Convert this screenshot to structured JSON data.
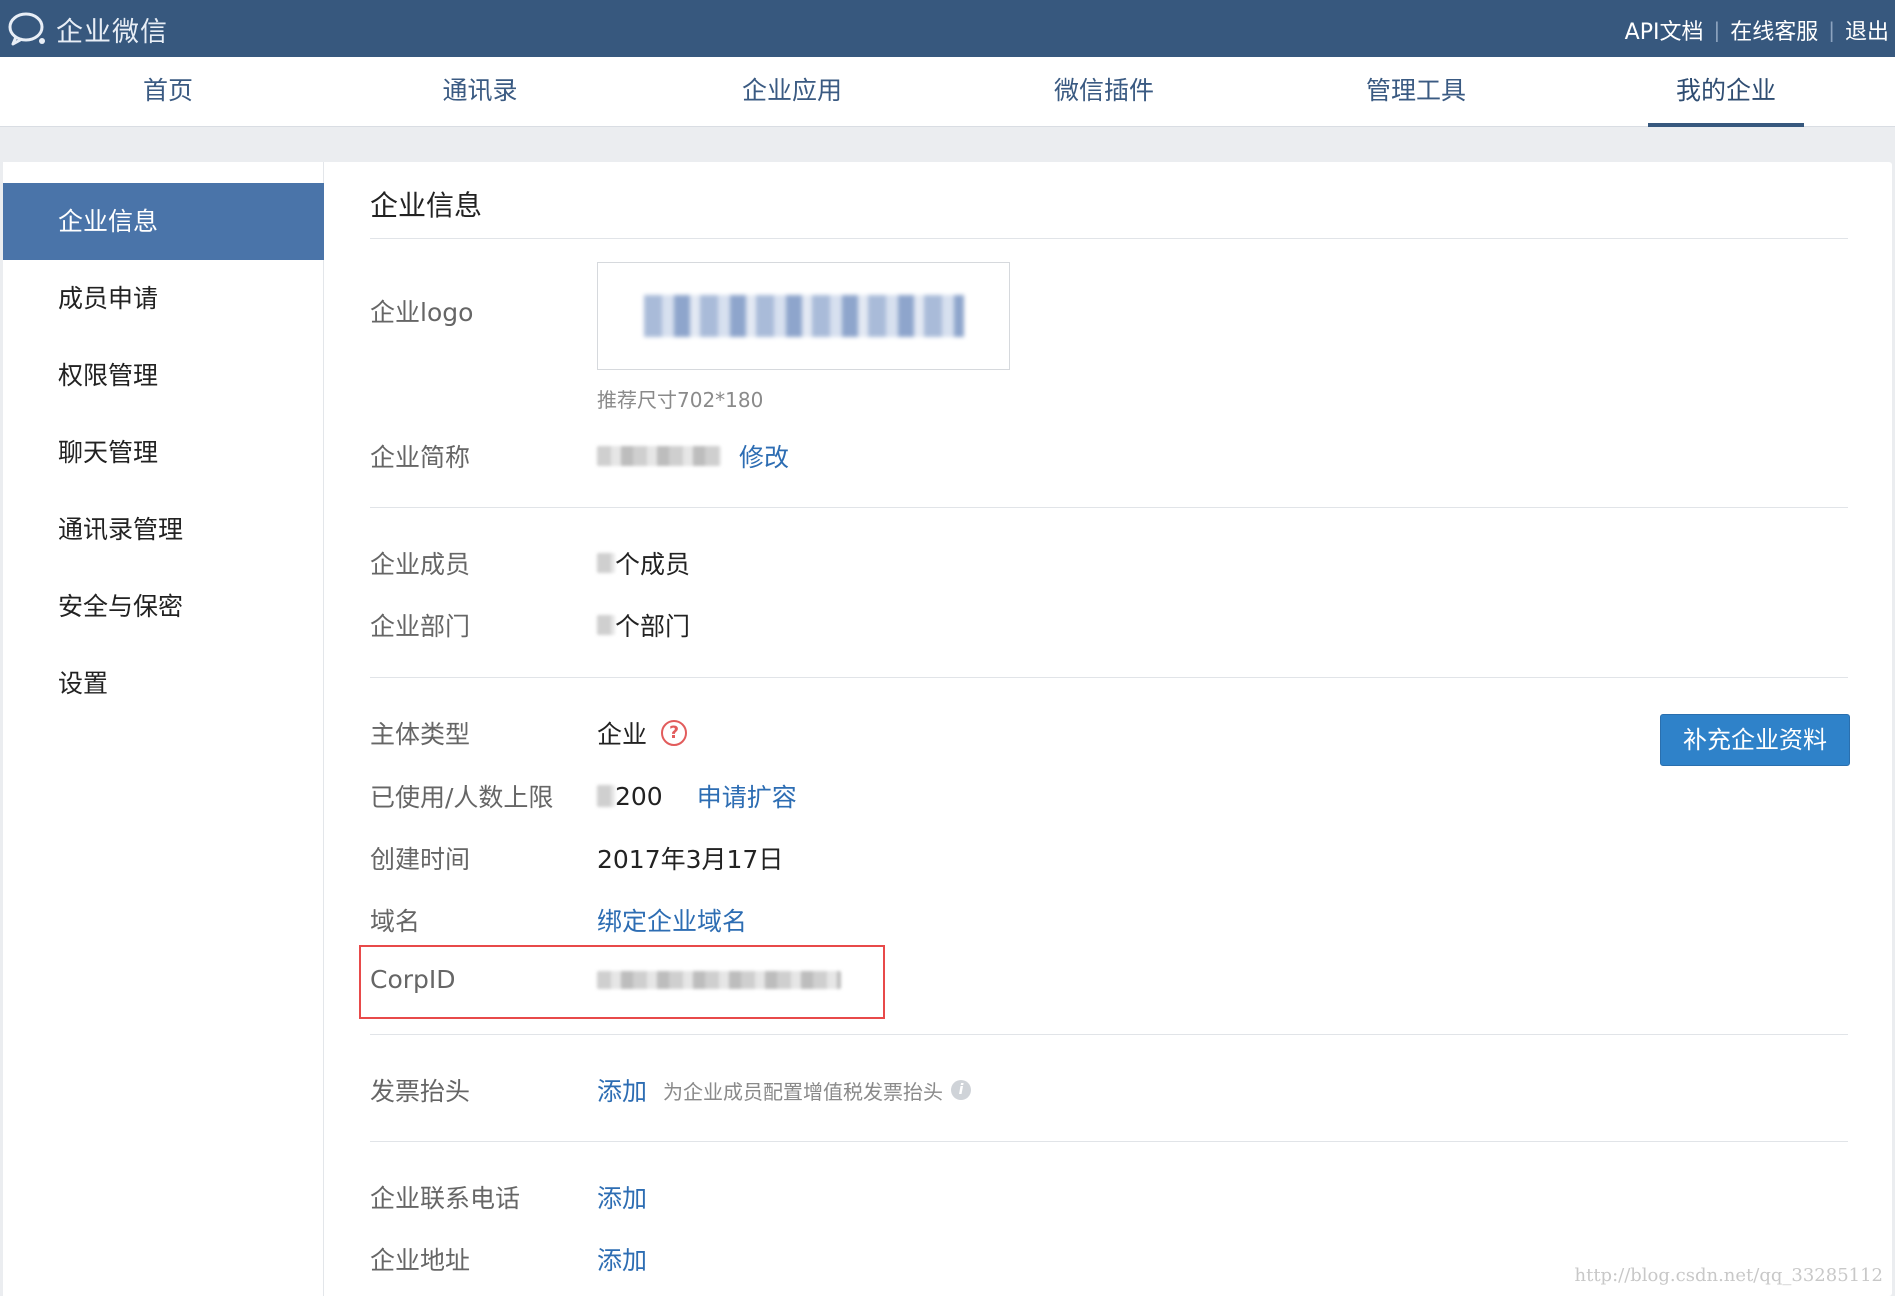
{
  "topbar": {
    "app_name": "企业微信",
    "links": [
      "API文档",
      "在线客服",
      "退出"
    ]
  },
  "nav": {
    "items": [
      "首页",
      "通讯录",
      "企业应用",
      "微信插件",
      "管理工具",
      "我的企业"
    ],
    "active_index": 5
  },
  "sidebar": {
    "items": [
      "企业信息",
      "成员申请",
      "权限管理",
      "聊天管理",
      "通讯录管理",
      "安全与保密",
      "设置"
    ],
    "active_index": 0
  },
  "page": {
    "title": "企业信息",
    "logo": {
      "label": "企业logo",
      "hint": "推荐尺寸702*180"
    },
    "short_name": {
      "label": "企业简称",
      "action": "修改"
    },
    "members": {
      "label": "企业成员",
      "value_suffix": "个成员"
    },
    "departments": {
      "label": "企业部门",
      "value_suffix": "个部门"
    },
    "entity_type": {
      "label": "主体类型",
      "value": "企业",
      "help": "?"
    },
    "capacity": {
      "label": "已使用/人数上限",
      "value": "200",
      "action": "申请扩容"
    },
    "created": {
      "label": "创建时间",
      "value": "2017年3月17日"
    },
    "domain": {
      "label": "域名",
      "action": "绑定企业域名"
    },
    "corpid": {
      "label": "CorpID"
    },
    "invoice": {
      "label": "发票抬头",
      "action": "添加",
      "desc": "为企业成员配置增值税发票抬头"
    },
    "phone": {
      "label": "企业联系电话",
      "action": "添加"
    },
    "address": {
      "label": "企业地址",
      "action": "添加"
    },
    "supplement_button": "补充企业资料"
  },
  "watermark": "http://blog.csdn.net/qq_33285112",
  "colors": {
    "topbar": "#37587e",
    "sidebar_active": "#4a74a9",
    "link": "#2d6db3",
    "primary_button": "#2f82c9",
    "highlight_border": "#e84a4a"
  }
}
